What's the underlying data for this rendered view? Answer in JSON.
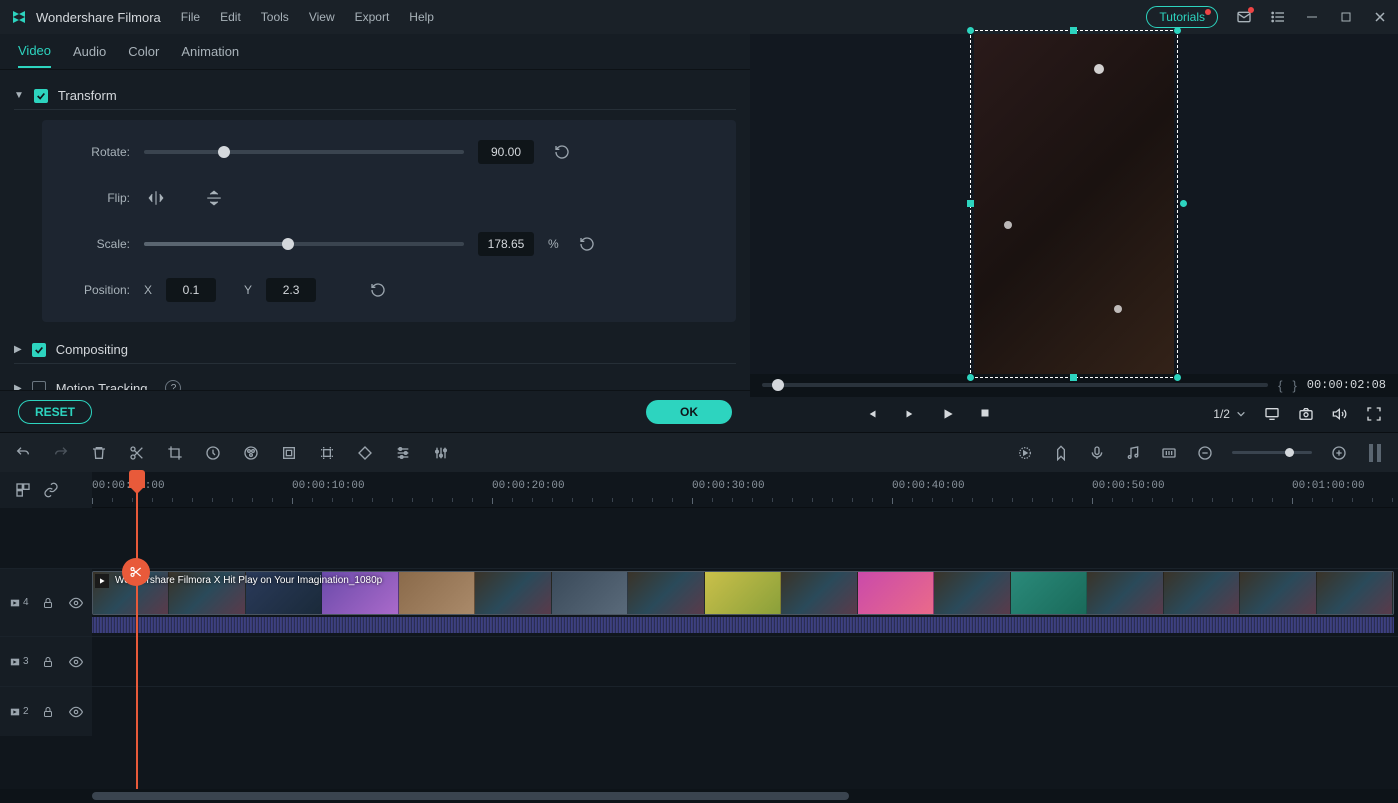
{
  "titlebar": {
    "app_name": "Wondershare Filmora",
    "menus": [
      "File",
      "Edit",
      "Tools",
      "View",
      "Export",
      "Help"
    ],
    "tutorials_label": "Tutorials"
  },
  "tabs": {
    "video": "Video",
    "audio": "Audio",
    "color": "Color",
    "animation": "Animation"
  },
  "sections": {
    "transform": {
      "title": "Transform",
      "rotate_label": "Rotate:",
      "rotate_value": "90.00",
      "rotate_pct": 25,
      "flip_label": "Flip:",
      "scale_label": "Scale:",
      "scale_value": "178.65",
      "scale_unit": "%",
      "scale_pct": 45,
      "position_label": "Position:",
      "pos_x_label": "X",
      "pos_x_value": "0.1",
      "pos_y_label": "Y",
      "pos_y_value": "2.3"
    },
    "compositing": {
      "title": "Compositing"
    },
    "motion_tracking": {
      "title": "Motion Tracking"
    }
  },
  "buttons": {
    "reset": "RESET",
    "ok": "OK"
  },
  "preview": {
    "timecode": "00:00:02:08",
    "scale_label": "1/2"
  },
  "timeline": {
    "markers": [
      "00:00:00:00",
      "00:00:10:00",
      "00:00:20:00",
      "00:00:30:00",
      "00:00:40:00",
      "00:00:50:00",
      "00:01:00:00"
    ],
    "tracks": [
      {
        "id": "4",
        "clip_title": "Wondershare Filmora X   Hit Play on Your Imagination_1080p"
      },
      {
        "id": "3"
      },
      {
        "id": "2"
      }
    ]
  }
}
